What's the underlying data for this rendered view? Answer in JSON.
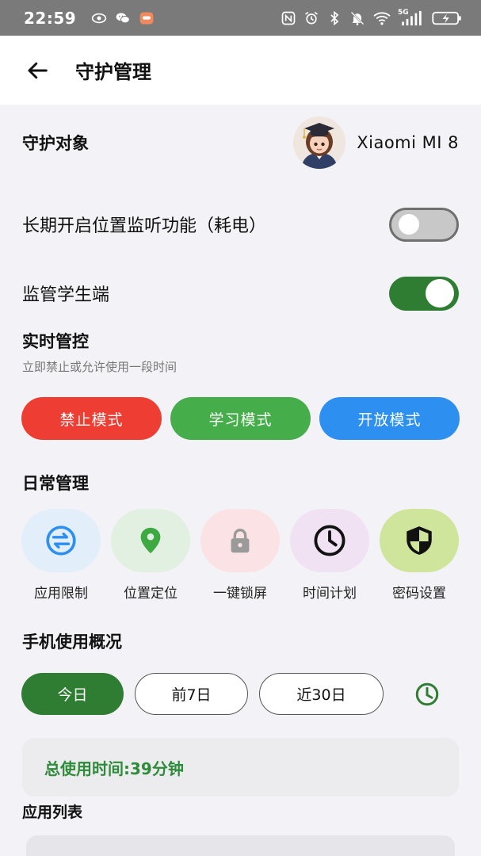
{
  "status_bar": {
    "time": "22:59",
    "left_icons": [
      "eye-icon",
      "wechat-icon",
      "message-app-icon"
    ],
    "right_icons": [
      "nfc-icon",
      "alarm-icon",
      "bluetooth-icon",
      "mute-icon",
      "wifi-icon",
      "signal-5g-icon",
      "battery-charging-icon"
    ],
    "network_label": "5G"
  },
  "app_bar": {
    "title": "守护管理",
    "back_icon": "arrow-left-icon"
  },
  "guard_target": {
    "label": "守护对象",
    "device_name": "Xiaomi MI 8"
  },
  "location_monitor": {
    "label": "长期开启位置监听功能（耗电）",
    "enabled": false
  },
  "supervise_student": {
    "label": "监管学生端",
    "enabled": true
  },
  "realtime": {
    "title": "实时管控",
    "subtitle": "立即禁止或允许使用一段时间",
    "modes": [
      {
        "label": "禁止模式",
        "color": "#ee3d33"
      },
      {
        "label": "学习模式",
        "color": "#45ad4a"
      },
      {
        "label": "开放模式",
        "color": "#2d8ff0"
      }
    ]
  },
  "daily": {
    "title": "日常管理",
    "features": [
      {
        "label": "应用限制",
        "icon": "swap-arrows-icon",
        "bg": "#e2eef9",
        "fg": "#2d8ff0"
      },
      {
        "label": "位置定位",
        "icon": "location-pin-icon",
        "bg": "#e1f0e1",
        "fg": "#3ea843"
      },
      {
        "label": "一键锁屏",
        "icon": "lock-icon",
        "bg": "#fbe2e4",
        "fg": "#9a9a9a"
      },
      {
        "label": "时间计划",
        "icon": "clock-icon",
        "bg": "#f0e2f2",
        "fg": "#111111"
      },
      {
        "label": "密码设置",
        "icon": "shield-icon",
        "bg": "#cfe59c",
        "fg": "#111111"
      }
    ]
  },
  "usage": {
    "title": "手机使用概况",
    "ranges": [
      "今日",
      "前7日",
      "近30日"
    ],
    "selected_range": "今日",
    "history_icon": "clock-icon",
    "total": "总使用时间:39分钟",
    "accent": "#2e7d32"
  },
  "app_list": {
    "title": "应用列表"
  }
}
